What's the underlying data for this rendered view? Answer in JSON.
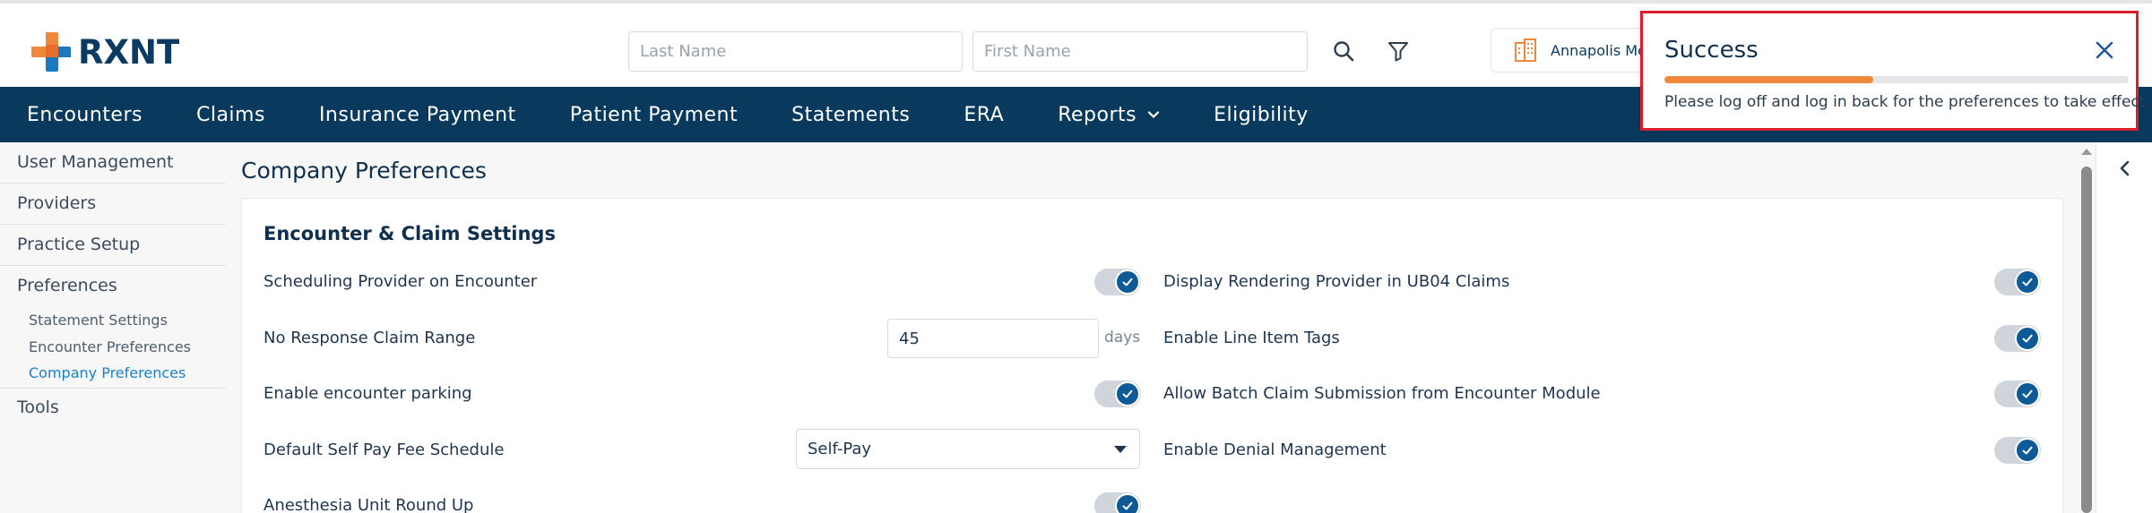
{
  "header": {
    "logo_text": "RXNT",
    "last_name_placeholder": "Last Name",
    "first_name_placeholder": "First Name",
    "practice_name": "Annapolis Me",
    "brand_color": "#0b3a63",
    "accent_color": "#f0883c"
  },
  "nav": {
    "items": [
      "Encounters",
      "Claims",
      "Insurance Payment",
      "Patient Payment",
      "Statements",
      "ERA",
      "Reports",
      "Eligibility"
    ],
    "background": "#093a5e"
  },
  "sidebar": {
    "items": [
      "User Management",
      "Providers",
      "Practice Setup",
      "Preferences",
      "Tools"
    ],
    "sub_items": [
      "Statement Settings",
      "Encounter Preferences",
      "Company Preferences"
    ],
    "active_sub": "Company Preferences"
  },
  "main": {
    "page_title": "Company Preferences",
    "section_title": "Encounter & Claim Settings",
    "left_settings": [
      {
        "label": "Scheduling Provider on Encounter",
        "control": "toggle",
        "enabled": true
      },
      {
        "label": "No Response Claim Range",
        "control": "number",
        "value": "45",
        "unit": "days"
      },
      {
        "label": "Enable encounter parking",
        "control": "toggle",
        "enabled": true
      },
      {
        "label": "Default Self Pay Fee Schedule",
        "control": "select",
        "value": "Self-Pay"
      },
      {
        "label": "Anesthesia Unit Round Up",
        "control": "toggle",
        "enabled": true
      }
    ],
    "right_settings": [
      {
        "label": "Display Rendering Provider in UB04 Claims",
        "control": "toggle",
        "enabled": true
      },
      {
        "label": "Enable Line Item Tags",
        "control": "toggle",
        "enabled": true
      },
      {
        "label": "Allow Batch Claim Submission from Encounter Module",
        "control": "toggle",
        "enabled": true
      },
      {
        "label": "Enable Denial Management",
        "control": "toggle",
        "enabled": true
      }
    ]
  },
  "toast": {
    "title": "Success",
    "message": "Please log off and log in back for the preferences to take effect.",
    "progress_fraction": 0.45,
    "border_color": "#dc1e2a"
  }
}
